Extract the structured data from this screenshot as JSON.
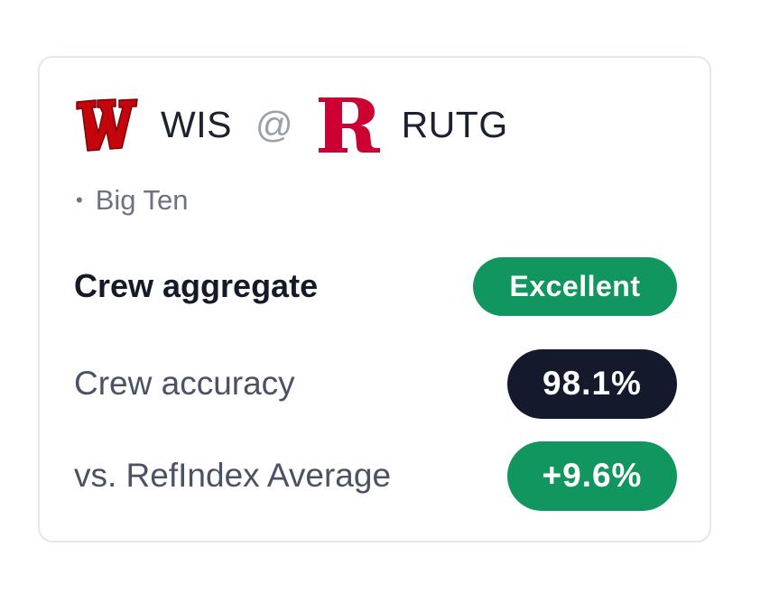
{
  "game": {
    "away_team": {
      "abbr": "WIS",
      "logo_icon": "wisconsin-w-logo",
      "logo_color": "#c5050c"
    },
    "separator": "@",
    "home_team": {
      "abbr": "RUTG",
      "logo_icon": "rutgers-r-logo",
      "logo_color": "#cc0033"
    },
    "conference_bullet": "•",
    "conference": "Big Ten"
  },
  "metrics": {
    "aggregate_label": "Crew aggregate",
    "aggregate_badge": "Excellent",
    "accuracy_label": "Crew accuracy",
    "accuracy_value": "98.1%",
    "vs_label": "vs. RefIndex Average",
    "vs_value": "+9.6%"
  },
  "colors": {
    "positive": "#12965f",
    "dark_badge": "#141a2b",
    "card_border": "#e3e7ee"
  }
}
